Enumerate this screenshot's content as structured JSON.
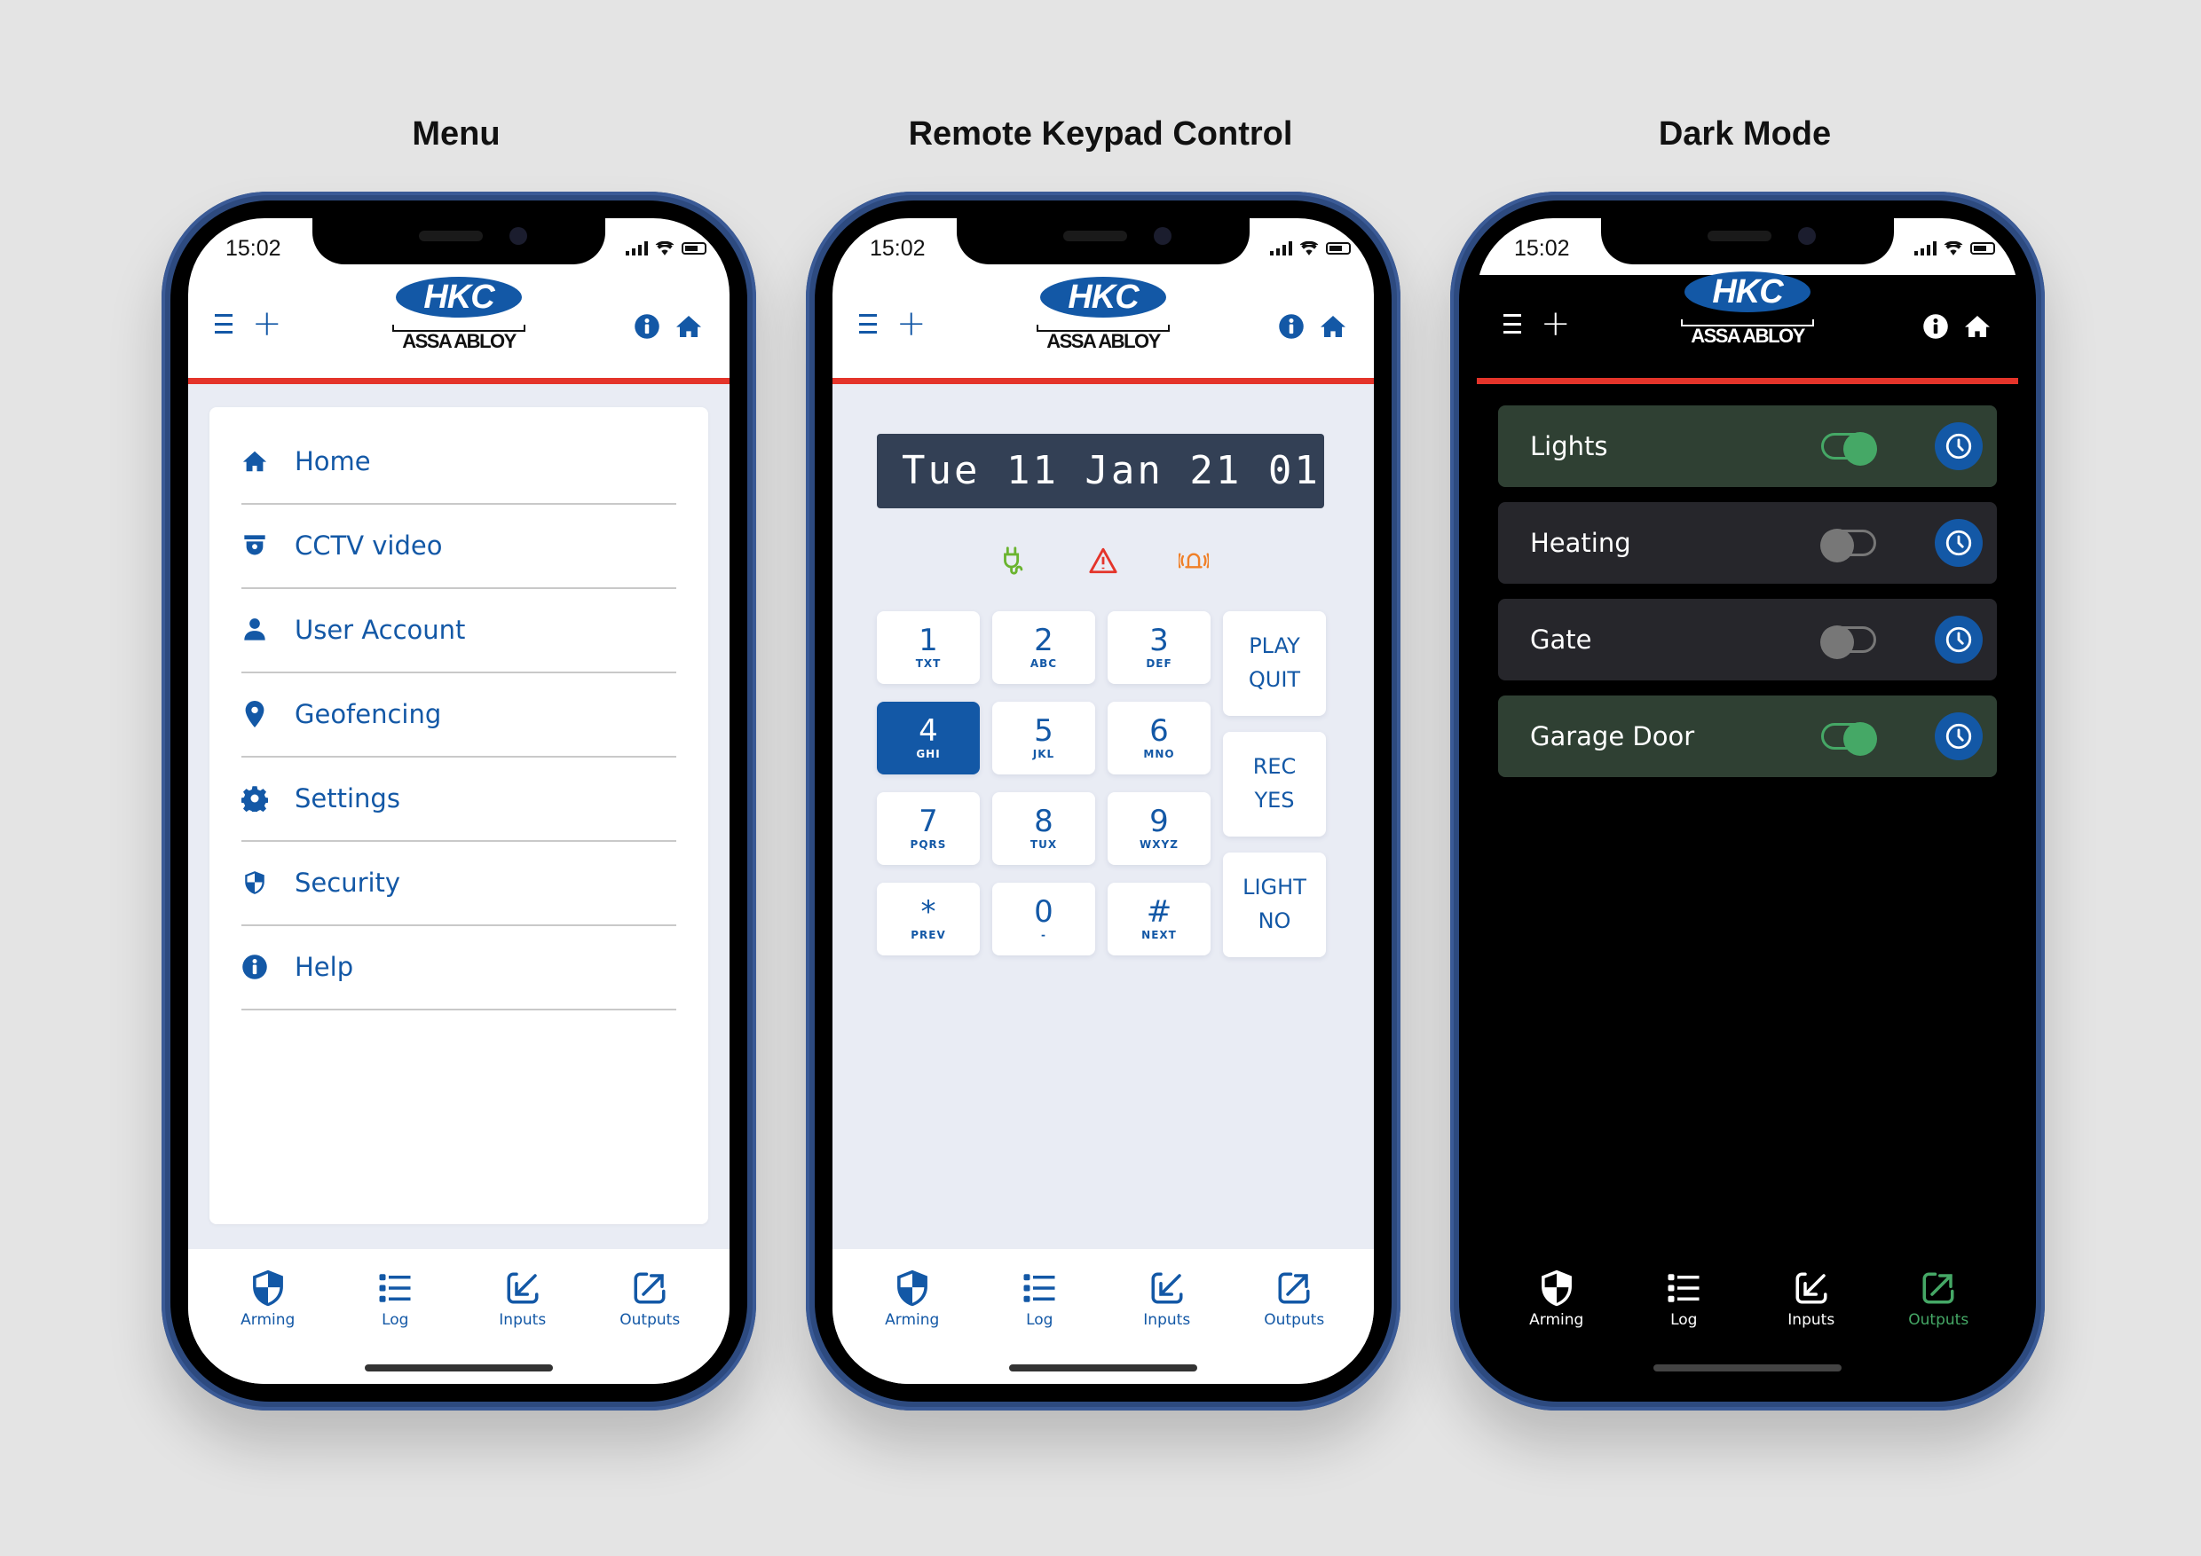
{
  "titles": [
    "Menu",
    "Remote Keypad Control",
    "Dark Mode"
  ],
  "status_bar": {
    "time": "15:02"
  },
  "logo": {
    "brand": "HKC",
    "parent": "ASSA ABLOY"
  },
  "header_icons": {
    "left": [
      "menu-icon",
      "plus-icon"
    ],
    "right": [
      "info-icon",
      "home-icon"
    ]
  },
  "colors": {
    "brand_blue": "#1358a6",
    "accent_red": "#e4342a",
    "on_green": "#45a866",
    "off_grey": "#777777",
    "lcd_bg": "#334055"
  },
  "menu": {
    "items": [
      {
        "label": "Home",
        "icon": "home-icon"
      },
      {
        "label": "CCTV video",
        "icon": "cctv-camera-icon"
      },
      {
        "label": "User Account",
        "icon": "user-icon"
      },
      {
        "label": "Geofencing",
        "icon": "map-pin-icon"
      },
      {
        "label": "Settings",
        "icon": "gear-icon"
      },
      {
        "label": "Security",
        "icon": "shield-icon"
      },
      {
        "label": "Help",
        "icon": "info-icon"
      }
    ]
  },
  "keypad": {
    "lcd_text": "Tue 11 Jan 21 01",
    "status_icons": [
      "power-plug-icon",
      "warning-triangle-icon",
      "alarm-bell-icon"
    ],
    "keys": [
      {
        "num": "1",
        "sub": "TXT"
      },
      {
        "num": "2",
        "sub": "ABC"
      },
      {
        "num": "3",
        "sub": "DEF"
      },
      {
        "num": "4",
        "sub": "GHI",
        "active": true
      },
      {
        "num": "5",
        "sub": "JKL"
      },
      {
        "num": "6",
        "sub": "MNO"
      },
      {
        "num": "7",
        "sub": "PQRS"
      },
      {
        "num": "8",
        "sub": "TUX"
      },
      {
        "num": "9",
        "sub": "WXYZ"
      },
      {
        "num": "*",
        "sub": "PREV"
      },
      {
        "num": "0",
        "sub": "-"
      },
      {
        "num": "#",
        "sub": "NEXT"
      }
    ],
    "function_keys": [
      {
        "line1": "PLAY",
        "line2": "QUIT"
      },
      {
        "line1": "REC",
        "line2": "YES"
      },
      {
        "line1": "LIGHT",
        "line2": "NO"
      }
    ]
  },
  "outputs": [
    {
      "name": "Lights",
      "on": true
    },
    {
      "name": "Heating",
      "on": false
    },
    {
      "name": "Gate",
      "on": false
    },
    {
      "name": "Garage Door",
      "on": true
    }
  ],
  "tabbar": {
    "tabs": [
      {
        "label": "Arming",
        "icon": "shield-icon"
      },
      {
        "label": "Log",
        "icon": "list-icon"
      },
      {
        "label": "Inputs",
        "icon": "input-arrow-icon"
      },
      {
        "label": "Outputs",
        "icon": "output-arrow-icon"
      }
    ],
    "dark_active": "Outputs"
  }
}
